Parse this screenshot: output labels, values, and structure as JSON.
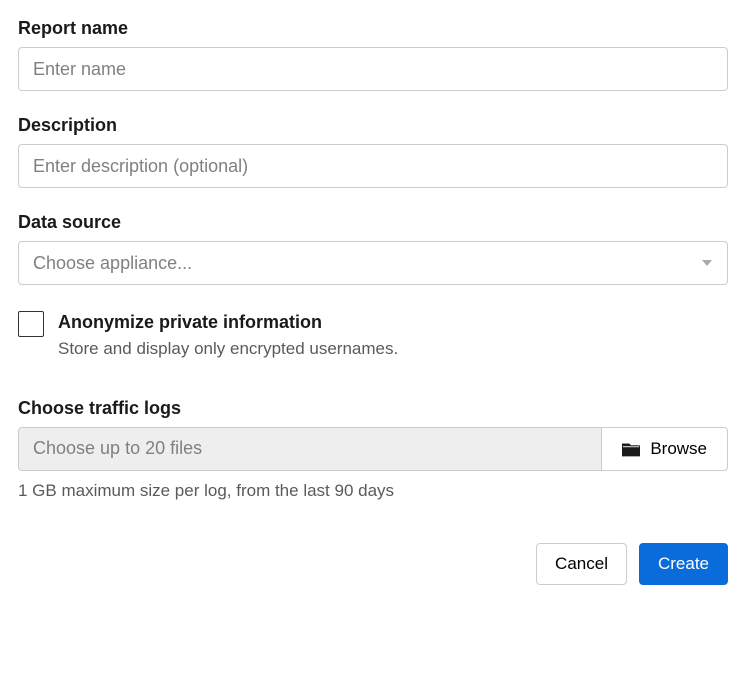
{
  "report_name": {
    "label": "Report name",
    "placeholder": "Enter name",
    "value": ""
  },
  "description": {
    "label": "Description",
    "placeholder": "Enter description (optional)",
    "value": ""
  },
  "data_source": {
    "label": "Data source",
    "placeholder": "Choose appliance..."
  },
  "anonymize": {
    "label": "Anonymize private information",
    "desc": "Store and display only encrypted usernames.",
    "checked": false
  },
  "traffic_logs": {
    "label": "Choose traffic logs",
    "placeholder": "Choose up to 20 files",
    "browse_label": "Browse",
    "hint": "1 GB maximum size per log, from the last 90 days"
  },
  "actions": {
    "cancel": "Cancel",
    "create": "Create"
  }
}
